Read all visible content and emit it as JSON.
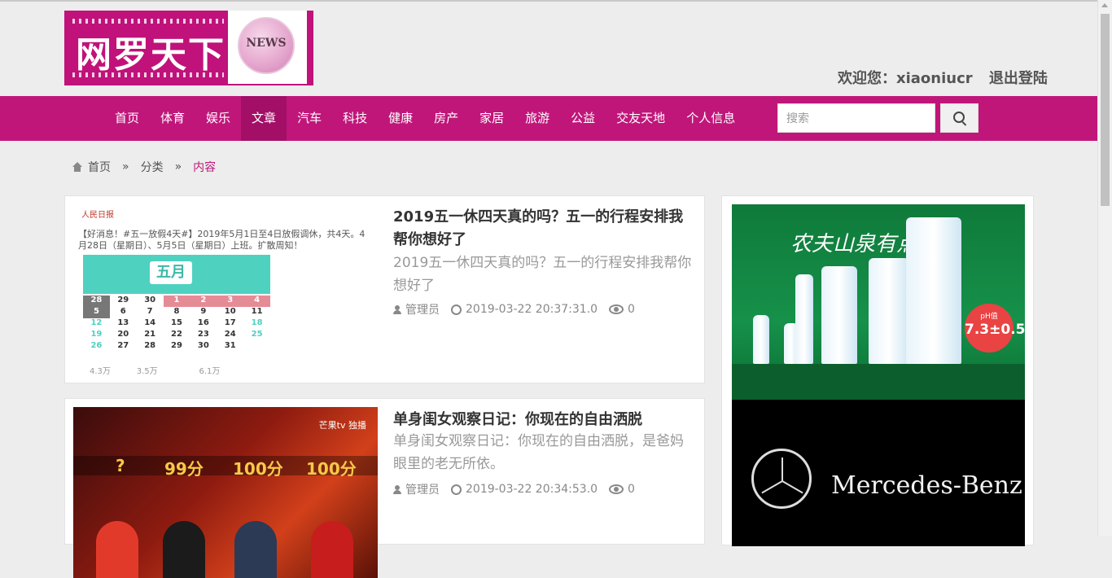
{
  "header": {
    "logo_text": "网罗天下",
    "logo_badge": "NEWS",
    "welcome_user": "欢迎您：xiaoniucr",
    "logout": "退出登陆"
  },
  "nav": {
    "items": [
      {
        "label": "首页"
      },
      {
        "label": "体育"
      },
      {
        "label": "娱乐"
      },
      {
        "label": "文章",
        "active": true
      },
      {
        "label": "汽车"
      },
      {
        "label": "科技"
      },
      {
        "label": "健康"
      },
      {
        "label": "房产"
      },
      {
        "label": "家居"
      },
      {
        "label": "旅游"
      },
      {
        "label": "公益"
      },
      {
        "label": "交友天地"
      },
      {
        "label": "个人信息"
      }
    ],
    "search_placeholder": "搜索"
  },
  "breadcrumb": {
    "home": "首页",
    "category": "分类",
    "current": "内容",
    "separator": "»"
  },
  "articles": [
    {
      "title": "2019五一休四天真的吗？五一的行程安排我帮你想好了",
      "desc": "2019五一休四天真的吗？五一的行程安排我帮你想好了",
      "author": "管理员",
      "date": "2019-03-22 20:37:31.0",
      "views": "0",
      "thumb": {
        "source": "人民日报",
        "text": "【好消息！#五一放假4天#】2019年5月1日至4日放假调休，共4天。4月28日（星期日）、5月5日（星期日）上班。扩散周知！",
        "month": "五月",
        "stats": [
          "4.3万",
          "3.5万",
          "6.1万"
        ]
      }
    },
    {
      "title": "单身闺女观察日记：你现在的自由洒脱",
      "desc": "单身闺女观察日记：你现在的自由洒脱，是爸妈眼里的老无所依。",
      "author": "管理员",
      "date": "2019-03-22 20:34:53.0",
      "views": "0",
      "thumb": {
        "logo": "芒果tv 独播",
        "scores": [
          "?",
          "99分",
          "100分",
          "100分"
        ]
      }
    }
  ],
  "sidebar": {
    "ad1_text": "农夫山泉有点甜",
    "ad1_ph_label": "pH值",
    "ad1_ph_value": "7.3±0.5",
    "ad2_text": "Mercedes-Benz"
  },
  "colors": {
    "brand": "#c0167a",
    "nav_active": "#a30e66"
  }
}
